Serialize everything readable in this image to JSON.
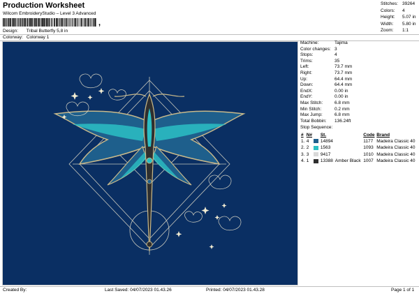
{
  "header": {
    "title": "Production Worksheet",
    "subtitle": "Wilcom EmbroideryStudio – Level 3 Advanced",
    "design_label": "Design:",
    "design_value": "Tribal Butterfly 5,8 in",
    "colorway_label": "Colorway:",
    "colorway_value": "Colorway 1"
  },
  "stats": {
    "stitches_label": "Stitches:",
    "stitches_value": "39264",
    "colors_label": "Colors:",
    "colors_value": "4",
    "height_label": "Height:",
    "height_value": "5.07 in",
    "width_label": "Width:",
    "width_value": "5.80 in",
    "zoom_label": "Zoom:",
    "zoom_value": "1:1"
  },
  "machine": {
    "machine_label": "Machine:",
    "machine_value": "Tajima",
    "color_changes_label": "Color changes:",
    "color_changes_value": "3",
    "stops_label": "Stops:",
    "stops_value": "4",
    "trims_label": "Trims:",
    "trims_value": "35",
    "left_label": "Left:",
    "left_value": "73.7 mm",
    "right_label": "Right:",
    "right_value": "73.7 mm",
    "up_label": "Up:",
    "up_value": "64.4 mm",
    "down_label": "Down:",
    "down_value": "64.4 mm",
    "endx_label": "EndX:",
    "endx_value": "0.00 in",
    "endy_label": "EndY:",
    "endy_value": "0.00 in",
    "max_stitch_label": "Max Stitch:",
    "max_stitch_value": "6.8 mm",
    "min_stitch_label": "Min Stitch:",
    "min_stitch_value": "0.2 mm",
    "max_jump_label": "Max Jump:",
    "max_jump_value": "6.8 mm",
    "total_bobbin_label": "Total Bobbin:",
    "total_bobbin_value": "136.24ft"
  },
  "stop_sequence": {
    "title": "Stop Sequence:",
    "headers": [
      "#",
      "N#",
      "",
      "St.",
      "Code",
      "Brand"
    ],
    "rows": [
      {
        "num": "1.",
        "n": "4",
        "color": "#1e5f8c",
        "st": "14894",
        "name": "",
        "code": "1177",
        "brand": "Madeira Classic 40"
      },
      {
        "num": "2.",
        "n": "2",
        "color": "#2bbfc4",
        "st": "1563",
        "name": "",
        "code": "1093",
        "brand": "Madeira Classic 40"
      },
      {
        "num": "3.",
        "n": "3",
        "color": "#d9d9d9",
        "st": "9417",
        "name": "",
        "code": "1010",
        "brand": "Madeira Classic 40"
      },
      {
        "num": "4.",
        "n": "1",
        "color": "#2f2f2f",
        "st": "13388",
        "name": "Amber Black",
        "code": "1007",
        "brand": "Madeira Classic 40"
      }
    ]
  },
  "footer": {
    "created_by": "Created By:",
    "last_saved": "Last Saved: 04/07/2023 01.43.26",
    "printed": "Printed: 04/07/2023 01.43.28",
    "page": "Page 1 of 1"
  },
  "canvas": {
    "background": "#0a2f63",
    "design_colors": [
      "#1e5f8c",
      "#2bbfc4",
      "#d9d9d9",
      "#2f2f2f"
    ]
  }
}
